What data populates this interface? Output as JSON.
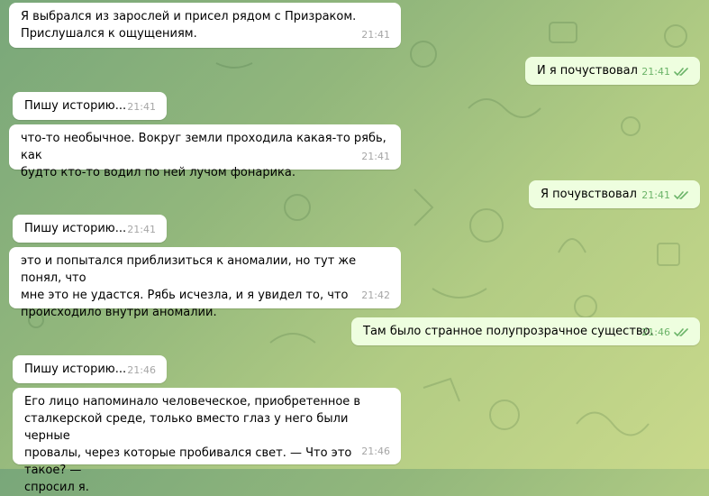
{
  "messages": [
    {
      "id": "m1",
      "direction": "in",
      "text": "Я выбрался из зарослей и присел рядом с Призраком.\nПрислушался к ощущениям.",
      "time": "21:41"
    },
    {
      "id": "m2",
      "direction": "out",
      "text": "И я почуствовал",
      "time": "21:41"
    },
    {
      "id": "m3",
      "direction": "in",
      "text": "Пишу историю...",
      "time": "21:41"
    },
    {
      "id": "m4",
      "direction": "in",
      "text": "что-то необычное. Вокруг земли проходила какая-то рябь, как\nбудто кто-то водил по ней лучом фонарика.",
      "time": "21:41"
    },
    {
      "id": "m5",
      "direction": "out",
      "text": "Я почувствовал",
      "time": "21:41"
    },
    {
      "id": "m6",
      "direction": "in",
      "text": "Пишу историю...",
      "time": "21:41"
    },
    {
      "id": "m7",
      "direction": "in",
      "text": "это и попытался приблизиться к аномалии, но тут же понял, что\nмне это не удастся. Рябь исчезла, и я увидел то, что\nпроисходило внутри аномалии.",
      "time": "21:42"
    },
    {
      "id": "m8",
      "direction": "out",
      "text": "Там было странное полупрозрачное существо.",
      "time": "21:46"
    },
    {
      "id": "m9",
      "direction": "in",
      "text": "Пишу историю...",
      "time": "21:46"
    },
    {
      "id": "m10",
      "direction": "in",
      "text": "Его лицо напоминало человеческое, приобретенное в\nсталкерской среде, только вместо глаз у него были черные\nпровалы, через которые пробивался свет. — Что это такое? —\nспросил я.",
      "time": "21:46"
    }
  ],
  "colors": {
    "incoming_bubble": "#ffffff",
    "outgoing_bubble": "#eefedf",
    "outgoing_meta": "#6cb469",
    "incoming_meta": "#a6a6a6"
  },
  "icons": {
    "read_receipt": "double-check-icon"
  }
}
